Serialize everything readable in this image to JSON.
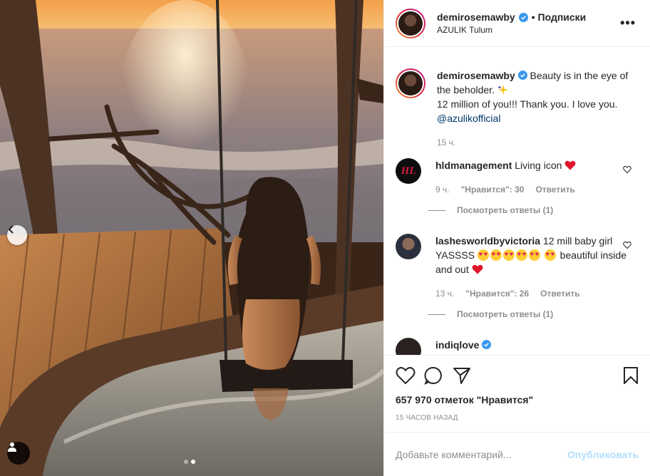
{
  "post": {
    "username": "demirosemawby",
    "follow_label": "• Подписки",
    "location": "AZULIK Tulum",
    "more_label": "•••"
  },
  "caption": {
    "username": "demirosemawby",
    "text_1": "Beauty is in the eye of the beholder.",
    "text_2": "12 million of you!!! Thank you. I love you.",
    "mention": "@azulikofficial",
    "time": "15 ч."
  },
  "comments": [
    {
      "username": "hldmanagement",
      "text": "Living icon",
      "time": "9 ч.",
      "likes": "\"Нравится\": 30",
      "reply": "Ответить",
      "view_replies": "Посмотреть ответы (1)"
    },
    {
      "username": "lashesworldbyvictoria",
      "text_1": "12 mill baby girl YASSSS",
      "text_2": "beautiful inside and out",
      "time": "13 ч.",
      "likes": "\"Нравится\": 26",
      "reply": "Ответить",
      "view_replies": "Посмотреть ответы (1)"
    },
    {
      "username": "indiqlove"
    }
  ],
  "actions": {
    "likes_count": "657 970 отметок \"Нравится\"",
    "time_ago": "15 часов назад"
  },
  "add_comment": {
    "placeholder": "Добавьте комментарий...",
    "post_label": "Опубликовать"
  },
  "carousel": {
    "total": 2,
    "active": 2
  },
  "colors": {
    "verified": "#3897f0",
    "link": "#00376b",
    "muted": "#8e8e8e",
    "post_disabled": "#b2dffc",
    "like_heart": "#ed4956"
  }
}
